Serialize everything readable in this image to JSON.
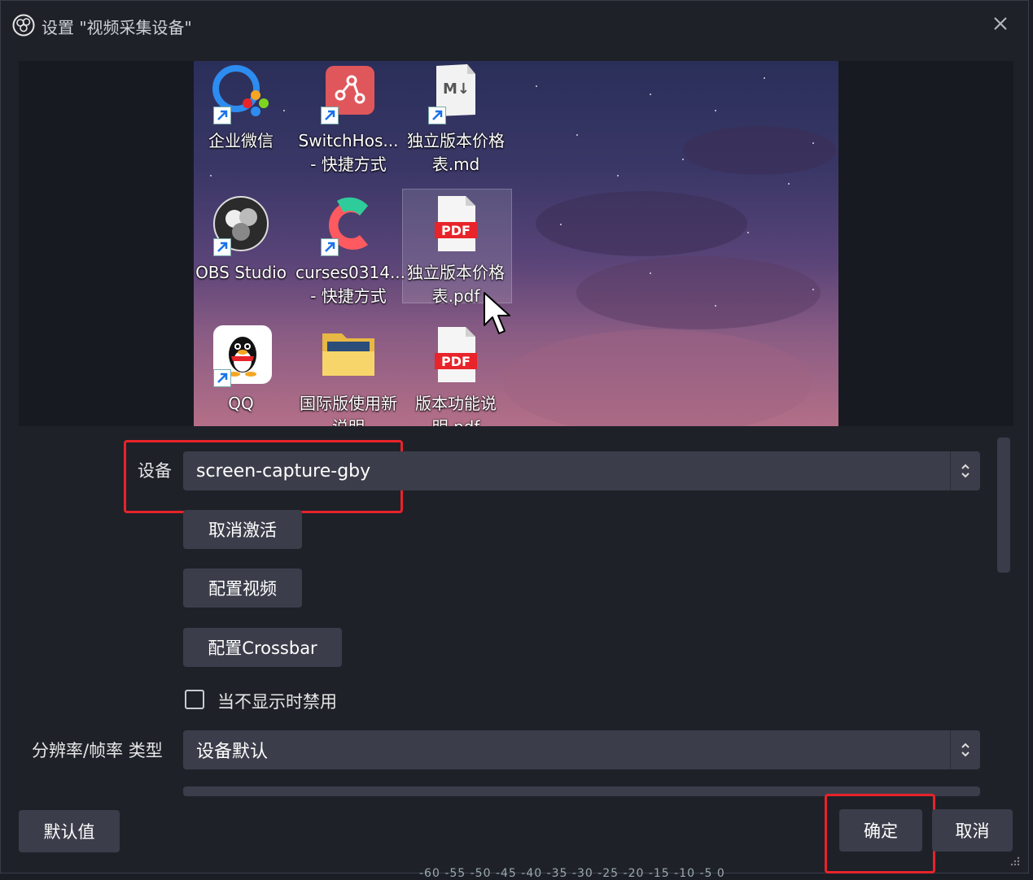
{
  "window": {
    "title": "设置 \"视频采集设备\"",
    "close_icon": "close-icon"
  },
  "desktop_icons": [
    {
      "name": "wecom",
      "label1": "企业微信",
      "label2": ""
    },
    {
      "name": "switchhosts",
      "label1": "SwitchHos...",
      "label2": "- 快捷方式"
    },
    {
      "name": "md-file",
      "label1": "独立版本价格",
      "label2": "表.md"
    },
    {
      "name": "obs",
      "label1": "OBS Studio",
      "label2": ""
    },
    {
      "name": "curses",
      "label1": "curses0314...",
      "label2": "- 快捷方式"
    },
    {
      "name": "pdf-price",
      "label1": "独立版本价格",
      "label2": "表.pdf"
    },
    {
      "name": "qq",
      "label1": "QQ",
      "label2": ""
    },
    {
      "name": "folder",
      "label1": "国际版使用新",
      "label2": "说明"
    },
    {
      "name": "pdf-features",
      "label1": "版本功能说",
      "label2": "明.pdf"
    }
  ],
  "pdf_badge": "PDF",
  "md_badge": "M↓",
  "properties": {
    "device_label": "设备",
    "device_value": "screen-capture-gby",
    "deactivate_button": "取消激活",
    "configure_video_button": "配置视频",
    "configure_crossbar_button": "配置Crossbar",
    "disable_when_hidden_label": "当不显示时禁用",
    "disable_when_hidden_checked": false,
    "resolution_type_label": "分辨率/帧率 类型",
    "resolution_type_value": "设备默认"
  },
  "footer": {
    "defaults_button": "默认值",
    "ok_button": "确定",
    "cancel_button": "取消",
    "ruler_text": "-60 -55 -50 -45 -40 -35 -30 -25 -20 -15 -10 -5 0"
  },
  "colors": {
    "highlight_red": "#e8232a",
    "dialog_bg": "#1f2129",
    "control_bg": "#3b3e4a"
  }
}
